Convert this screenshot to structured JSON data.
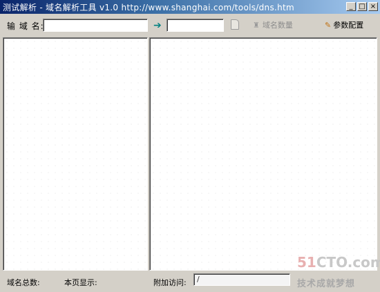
{
  "window": {
    "title": "测试解析 - 域名解析工具 v1.0 http://www.shanghai.com/tools/dns.htm",
    "min_label": "_",
    "max_label": "□",
    "close_label": "×"
  },
  "toolbar": {
    "domain_label": "输 域 名:",
    "domain_value": "",
    "second_value": "",
    "count_label": "域名数量",
    "config_label": "参数配置",
    "go_icon": "arrow-right-icon",
    "doc_icon": "document-icon",
    "count_icon": "counter-icon",
    "config_icon": "pencil-icon"
  },
  "status": {
    "total_label": "域名总数:",
    "page_label": "本页显示:",
    "extra_label": "附加访问:",
    "extra_value": "/"
  },
  "watermark": {
    "logo_red": "51",
    "logo_rest": "CTO.com",
    "slogan": "技术成就梦想"
  },
  "colors": {
    "window_bg": "#d4d0c8",
    "title_start": "#0a246a",
    "title_end": "#a6caf0",
    "go_icon": "#008080"
  }
}
